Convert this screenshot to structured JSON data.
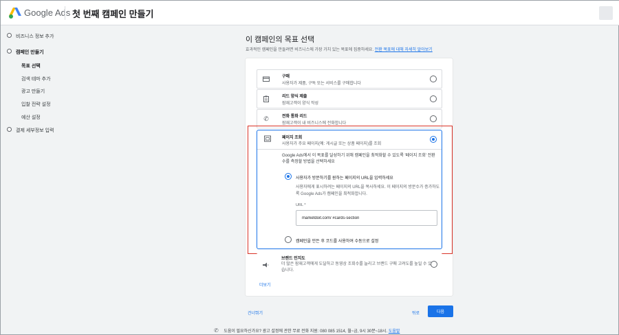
{
  "header": {
    "brand": "Google Ads",
    "page_title": "첫 번째 캠페인 만들기"
  },
  "sidebar": {
    "items": [
      {
        "label": "비즈니스 정보 추가"
      },
      {
        "label": "캠페인 만들기"
      },
      {
        "label": "목표 선택"
      },
      {
        "label": "검색 테마 추가"
      },
      {
        "label": "광고 만들기"
      },
      {
        "label": "입찰 전략 설정"
      },
      {
        "label": "예산 설정"
      },
      {
        "label": "결제 세부정보 입력"
      }
    ]
  },
  "main": {
    "title": "이 캠페인의 목표 선택",
    "subtitle": "효과적인 캠페인을 만들려면 비즈니스에 가장 가치 있는 목표에 집중하세요.",
    "subtitle_link": "전환 목표에 대해 자세히 알아보기",
    "goals": [
      {
        "icon": "credit-card-icon",
        "title": "구매",
        "desc": "사용자가 제품, 구독 또는 서비스를 구매합니다"
      },
      {
        "icon": "clipboard-icon",
        "title": "리드 양식 제출",
        "desc": "잠재고객이 양식 작성"
      },
      {
        "icon": "phone-icon",
        "title": "전화 통화 리드",
        "desc": "잠재고객이 내 비즈니스에 전화합니다"
      }
    ],
    "selected_goal": {
      "icon": "web-page-icon",
      "title": "페이지 조회",
      "desc": "사용자가 주요 페이지(예: 게시글 또는 상품 페이지)를 조회",
      "explain": "Google Ads에서 이 목표를 달성하기 위해 캠페인을 최적화할 수 있도록 '페이지 조회' 전환수를 측정할 방법을 선택하세요",
      "option1_label": "사용자가 방문하기를 원하는 페이지의 URL을 입력하세요",
      "option1_desc": "사용자에게 표시하려는 페이지의 URL을 복사하세요. 이 페이지의 방문수가 증가하도록 Google Ads가 캠페인을 최적화합니다.",
      "url_label": "URL *",
      "url_value": "marketdoit.com/ #cards-section",
      "option2_label": "캠페인을 만든 후 코드를 사용하여 수동으로 설정"
    },
    "brand_goal": {
      "icon": "megaphone-icon",
      "title": "브랜드 인지도",
      "desc": "더 많은 잠재고객에게 도달하고 동영상 조회수를 늘리고 브랜드 구매 고려도를 높일 수 있습니다."
    },
    "more_link": "더보기"
  },
  "actions": {
    "skip": "건너뛰기",
    "back": "뒤로",
    "next": "다음"
  },
  "footer": {
    "text": "도움이 필요하신가요? 광고 설정에 관한 무료 전화 지원: 080 085 1514, 월~금, 9시 30분~18시.",
    "link": "도움말"
  },
  "colors": {
    "accent": "#1a73e8",
    "highlight_box": "#d93025"
  }
}
